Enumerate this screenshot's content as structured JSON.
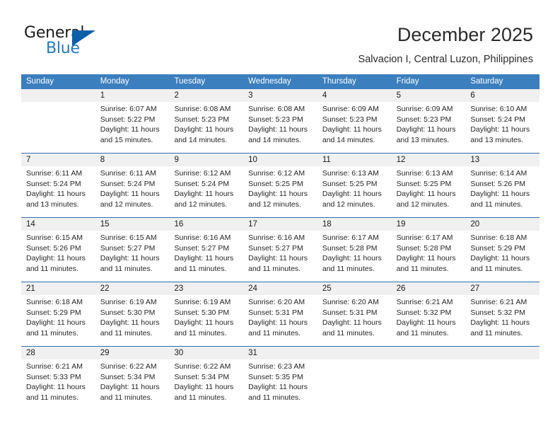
{
  "brand": {
    "name_top": "General",
    "name_bottom": "Blue",
    "color_black": "#1a1a1a",
    "color_blue": "#1f7ac0",
    "triangle_color": "#0b5ea8"
  },
  "header": {
    "title": "December 2025",
    "subtitle": "Salvacion I, Central Luzon, Philippines"
  },
  "theme": {
    "header_bg": "#3b7fbe",
    "header_text": "#ffffff",
    "daynum_bg": "#f0f0f0",
    "week_divider": "#2f6fae",
    "cell_bg": "#ffffff",
    "text": "#262626"
  },
  "weekdays": [
    "Sunday",
    "Monday",
    "Tuesday",
    "Wednesday",
    "Thursday",
    "Friday",
    "Saturday"
  ],
  "weeks": [
    {
      "days": [
        {
          "num": "",
          "sunrise": "",
          "sunset": "",
          "daylight": ""
        },
        {
          "num": "1",
          "sunrise": "Sunrise: 6:07 AM",
          "sunset": "Sunset: 5:22 PM",
          "daylight": "Daylight: 11 hours and 15 minutes."
        },
        {
          "num": "2",
          "sunrise": "Sunrise: 6:08 AM",
          "sunset": "Sunset: 5:23 PM",
          "daylight": "Daylight: 11 hours and 14 minutes."
        },
        {
          "num": "3",
          "sunrise": "Sunrise: 6:08 AM",
          "sunset": "Sunset: 5:23 PM",
          "daylight": "Daylight: 11 hours and 14 minutes."
        },
        {
          "num": "4",
          "sunrise": "Sunrise: 6:09 AM",
          "sunset": "Sunset: 5:23 PM",
          "daylight": "Daylight: 11 hours and 14 minutes."
        },
        {
          "num": "5",
          "sunrise": "Sunrise: 6:09 AM",
          "sunset": "Sunset: 5:23 PM",
          "daylight": "Daylight: 11 hours and 13 minutes."
        },
        {
          "num": "6",
          "sunrise": "Sunrise: 6:10 AM",
          "sunset": "Sunset: 5:24 PM",
          "daylight": "Daylight: 11 hours and 13 minutes."
        }
      ]
    },
    {
      "days": [
        {
          "num": "7",
          "sunrise": "Sunrise: 6:11 AM",
          "sunset": "Sunset: 5:24 PM",
          "daylight": "Daylight: 11 hours and 13 minutes."
        },
        {
          "num": "8",
          "sunrise": "Sunrise: 6:11 AM",
          "sunset": "Sunset: 5:24 PM",
          "daylight": "Daylight: 11 hours and 12 minutes."
        },
        {
          "num": "9",
          "sunrise": "Sunrise: 6:12 AM",
          "sunset": "Sunset: 5:24 PM",
          "daylight": "Daylight: 11 hours and 12 minutes."
        },
        {
          "num": "10",
          "sunrise": "Sunrise: 6:12 AM",
          "sunset": "Sunset: 5:25 PM",
          "daylight": "Daylight: 11 hours and 12 minutes."
        },
        {
          "num": "11",
          "sunrise": "Sunrise: 6:13 AM",
          "sunset": "Sunset: 5:25 PM",
          "daylight": "Daylight: 11 hours and 12 minutes."
        },
        {
          "num": "12",
          "sunrise": "Sunrise: 6:13 AM",
          "sunset": "Sunset: 5:25 PM",
          "daylight": "Daylight: 11 hours and 12 minutes."
        },
        {
          "num": "13",
          "sunrise": "Sunrise: 6:14 AM",
          "sunset": "Sunset: 5:26 PM",
          "daylight": "Daylight: 11 hours and 11 minutes."
        }
      ]
    },
    {
      "days": [
        {
          "num": "14",
          "sunrise": "Sunrise: 6:15 AM",
          "sunset": "Sunset: 5:26 PM",
          "daylight": "Daylight: 11 hours and 11 minutes."
        },
        {
          "num": "15",
          "sunrise": "Sunrise: 6:15 AM",
          "sunset": "Sunset: 5:27 PM",
          "daylight": "Daylight: 11 hours and 11 minutes."
        },
        {
          "num": "16",
          "sunrise": "Sunrise: 6:16 AM",
          "sunset": "Sunset: 5:27 PM",
          "daylight": "Daylight: 11 hours and 11 minutes."
        },
        {
          "num": "17",
          "sunrise": "Sunrise: 6:16 AM",
          "sunset": "Sunset: 5:27 PM",
          "daylight": "Daylight: 11 hours and 11 minutes."
        },
        {
          "num": "18",
          "sunrise": "Sunrise: 6:17 AM",
          "sunset": "Sunset: 5:28 PM",
          "daylight": "Daylight: 11 hours and 11 minutes."
        },
        {
          "num": "19",
          "sunrise": "Sunrise: 6:17 AM",
          "sunset": "Sunset: 5:28 PM",
          "daylight": "Daylight: 11 hours and 11 minutes."
        },
        {
          "num": "20",
          "sunrise": "Sunrise: 6:18 AM",
          "sunset": "Sunset: 5:29 PM",
          "daylight": "Daylight: 11 hours and 11 minutes."
        }
      ]
    },
    {
      "days": [
        {
          "num": "21",
          "sunrise": "Sunrise: 6:18 AM",
          "sunset": "Sunset: 5:29 PM",
          "daylight": "Daylight: 11 hours and 11 minutes."
        },
        {
          "num": "22",
          "sunrise": "Sunrise: 6:19 AM",
          "sunset": "Sunset: 5:30 PM",
          "daylight": "Daylight: 11 hours and 11 minutes."
        },
        {
          "num": "23",
          "sunrise": "Sunrise: 6:19 AM",
          "sunset": "Sunset: 5:30 PM",
          "daylight": "Daylight: 11 hours and 11 minutes."
        },
        {
          "num": "24",
          "sunrise": "Sunrise: 6:20 AM",
          "sunset": "Sunset: 5:31 PM",
          "daylight": "Daylight: 11 hours and 11 minutes."
        },
        {
          "num": "25",
          "sunrise": "Sunrise: 6:20 AM",
          "sunset": "Sunset: 5:31 PM",
          "daylight": "Daylight: 11 hours and 11 minutes."
        },
        {
          "num": "26",
          "sunrise": "Sunrise: 6:21 AM",
          "sunset": "Sunset: 5:32 PM",
          "daylight": "Daylight: 11 hours and 11 minutes."
        },
        {
          "num": "27",
          "sunrise": "Sunrise: 6:21 AM",
          "sunset": "Sunset: 5:32 PM",
          "daylight": "Daylight: 11 hours and 11 minutes."
        }
      ]
    },
    {
      "days": [
        {
          "num": "28",
          "sunrise": "Sunrise: 6:21 AM",
          "sunset": "Sunset: 5:33 PM",
          "daylight": "Daylight: 11 hours and 11 minutes."
        },
        {
          "num": "29",
          "sunrise": "Sunrise: 6:22 AM",
          "sunset": "Sunset: 5:34 PM",
          "daylight": "Daylight: 11 hours and 11 minutes."
        },
        {
          "num": "30",
          "sunrise": "Sunrise: 6:22 AM",
          "sunset": "Sunset: 5:34 PM",
          "daylight": "Daylight: 11 hours and 11 minutes."
        },
        {
          "num": "31",
          "sunrise": "Sunrise: 6:23 AM",
          "sunset": "Sunset: 5:35 PM",
          "daylight": "Daylight: 11 hours and 11 minutes."
        },
        {
          "num": "",
          "sunrise": "",
          "sunset": "",
          "daylight": ""
        },
        {
          "num": "",
          "sunrise": "",
          "sunset": "",
          "daylight": ""
        },
        {
          "num": "",
          "sunrise": "",
          "sunset": "",
          "daylight": ""
        }
      ]
    }
  ]
}
